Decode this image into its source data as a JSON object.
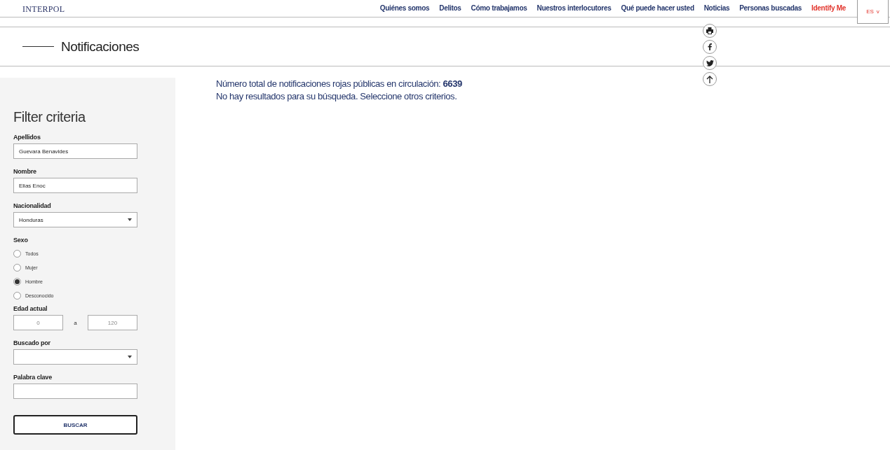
{
  "logo": "INTERPOL",
  "nav": [
    {
      "label": "Quiénes somos",
      "kind": "link"
    },
    {
      "label": "Delitos",
      "kind": "link"
    },
    {
      "label": "Cómo trabajamos",
      "kind": "link"
    },
    {
      "label": "Nuestros interlocutores",
      "kind": "link"
    },
    {
      "label": "Qué puede hacer usted",
      "kind": "link"
    },
    {
      "label": "Noticias",
      "kind": "link"
    },
    {
      "label": "Personas buscadas",
      "kind": "link"
    },
    {
      "label": "Identify Me",
      "kind": "highlight"
    }
  ],
  "language": {
    "label": "ES",
    "caret": "v"
  },
  "page_title": "Notificaciones",
  "share": [
    {
      "kind": "print"
    },
    {
      "kind": "facebook"
    },
    {
      "kind": "twitter"
    },
    {
      "kind": "top"
    }
  ],
  "filter": {
    "title": "Filter criteria",
    "fields": [
      {
        "kind": "text",
        "label": "Apellidos",
        "value": "Guevara Benavides"
      },
      {
        "kind": "text",
        "label": "Nombre",
        "value": "Elias Enoc"
      },
      {
        "kind": "select",
        "label": "Nacionalidad",
        "value": "Honduras"
      }
    ],
    "sex": {
      "label": "Sexo",
      "options": [
        {
          "label": "Todos",
          "selected": false
        },
        {
          "label": "Mujer",
          "selected": false
        },
        {
          "label": "Hombre",
          "selected": true
        },
        {
          "label": "Desconocido",
          "selected": false
        }
      ]
    },
    "age": {
      "label": "Edad actual",
      "from": "0",
      "separator": "a",
      "to": "120"
    },
    "fields2": [
      {
        "kind": "select",
        "label": "Buscado por"
      },
      {
        "kind": "text",
        "label": "Palabra clave"
      }
    ],
    "button": "BUSCAR"
  },
  "results": {
    "total_label": "Número total de notificaciones rojas públicas en circulación: **6639**",
    "message": "No hay resultados para su búsqueda. Seleccione otros criterios."
  }
}
